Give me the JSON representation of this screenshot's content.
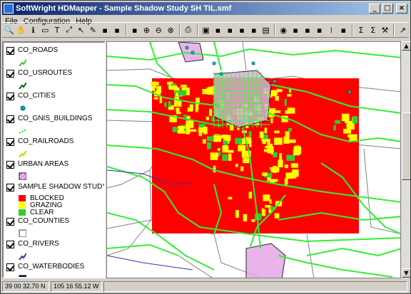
{
  "window": {
    "title": "SoftWright HDMapper - Sample Shadow Study SH TIL.smf",
    "controls": {
      "minimize": "_",
      "maximize": "□",
      "close": "×"
    }
  },
  "menu": [
    "File",
    "Configuration",
    "Help"
  ],
  "toolbar": [
    "zoom-area-icon",
    "pan-hand-icon",
    "info-icon",
    "select-rect-icon",
    "text-tool-icon",
    "line-tool-icon",
    "pointer-icon",
    "edit-tool-icon",
    "layer-folder-icon",
    "layer-stack-icon",
    "layer-colors-icon",
    "zoom-in-icon",
    "zoom-out-icon",
    "zoom-reset-icon",
    "print-icon",
    "save-icon",
    "copy-icon",
    "export-icon",
    "image-icon",
    "tag-icon",
    "dxf-icon",
    "pin-icon",
    "layers-red-icon",
    "layers-blue-icon",
    "layers-green-icon",
    "grid-dots-icon",
    "legend-box-icon",
    "sum-icon",
    "sum-plus-icon",
    "wrench-icon",
    "help-arrow-icon"
  ],
  "legend": {
    "layers": [
      {
        "name": "CO_ROADS",
        "color": "#33cc33",
        "symbol": "line"
      },
      {
        "name": "CO_USROUTES",
        "color": "#006600",
        "symbol": "line"
      },
      {
        "name": "CO_CITIES",
        "color": "#00aa99",
        "symbol": "dot"
      },
      {
        "name": "CO_GNIS_BUILDINGS",
        "color": "#33cc33",
        "symbol": "dash"
      },
      {
        "name": "CO_RAILROADS",
        "color": "#cccc00",
        "symbol": "line"
      },
      {
        "name": "URBAN AREAS",
        "color": "#cc66cc",
        "symbol": "hatch"
      },
      {
        "name": "SAMPLE SHADOW STUDY SH TIL (I",
        "symbol": "classes"
      },
      {
        "name": "CO_COUNTIES",
        "color": "#808080",
        "symbol": "box"
      },
      {
        "name": "CO_RIVERS",
        "color": "#3333aa",
        "symbol": "line"
      },
      {
        "name": "CO_WATERBODIES",
        "color": "#000080",
        "symbol": "fill"
      }
    ],
    "shadow_classes": [
      {
        "label": "BLOCKED",
        "color": "#ff0000"
      },
      {
        "label": "GRAZING",
        "color": "#ffff00"
      },
      {
        "label": "CLEAR",
        "color": "#33cc33"
      }
    ]
  },
  "status": {
    "latitude": "39 00 32.70 N",
    "longitude": "105 16 55.12 W"
  },
  "colors": {
    "blocked": "#ff0000",
    "grazing": "#ffff00",
    "clear": "#33cc33",
    "roads": "#33ff33",
    "counties": "#808080",
    "urban": "#cc66cc"
  }
}
